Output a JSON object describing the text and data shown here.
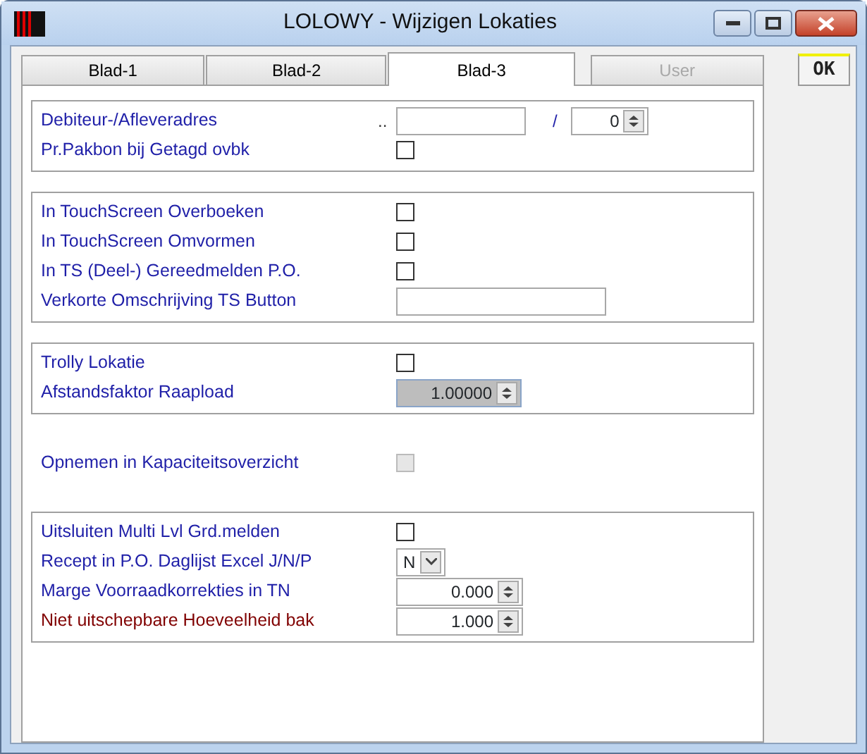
{
  "window": {
    "title": "LOLOWY - Wijzigen Lokaties"
  },
  "tabs": [
    {
      "label": "Blad-1",
      "selected": false,
      "disabled": false
    },
    {
      "label": "Blad-2",
      "selected": false,
      "disabled": false
    },
    {
      "label": "Blad-3",
      "selected": true,
      "disabled": false
    },
    {
      "label": "User",
      "selected": false,
      "disabled": true
    }
  ],
  "ok_button": {
    "label": "OK"
  },
  "groups": [
    {
      "bordered": true,
      "rows": [
        {
          "kind": "address",
          "label": "Debiteur-/Afleveradres",
          "color": "#1f1fa8",
          "prefix": "..",
          "separator": "/",
          "value": "0"
        },
        {
          "kind": "checkbox",
          "label": "Pr.Pakbon bij Getagd ovbk",
          "color": "#1f1fa8",
          "checked": false,
          "disabled": false
        }
      ]
    },
    {
      "bordered": true,
      "rows": [
        {
          "kind": "checkbox",
          "label": "In TouchScreen Overboeken",
          "color": "#1f1fa8",
          "checked": false,
          "disabled": false
        },
        {
          "kind": "checkbox",
          "label": "In TouchScreen Omvormen",
          "color": "#1f1fa8",
          "checked": false,
          "disabled": false
        },
        {
          "kind": "checkbox",
          "label": "In TS (Deel-) Gereedmelden P.O.",
          "color": "#1f1fa8",
          "checked": false,
          "disabled": false
        },
        {
          "kind": "text",
          "label": "Verkorte Omschrijving TS Button",
          "color": "#1f1fa8"
        }
      ]
    },
    {
      "bordered": true,
      "rows": [
        {
          "kind": "checkbox",
          "label": "Trolly Lokatie",
          "color": "#1f1fa8",
          "checked": false,
          "disabled": false
        },
        {
          "kind": "spin",
          "label": "Afstandsfaktor Raapload",
          "color": "#1f1fa8",
          "value": "1.00000",
          "disabled": true
        }
      ]
    },
    {
      "bordered": false,
      "rows": [
        {
          "kind": "checkbox",
          "label": "Opnemen in Kapaciteitsoverzicht",
          "color": "#1f1fa8",
          "checked": false,
          "disabled": true
        }
      ]
    },
    {
      "bordered": true,
      "rows": [
        {
          "kind": "checkbox",
          "label": "Uitsluiten Multi Lvl Grd.melden",
          "color": "#1f1fa8",
          "checked": false,
          "disabled": false
        },
        {
          "kind": "select",
          "label": "Recept in P.O. Daglijst Excel J/N/P",
          "color": "#1f1fa8",
          "value": "N"
        },
        {
          "kind": "spin",
          "label": "Marge Voorraadkorrekties in TN",
          "color": "#1f1fa8",
          "value": "0.000",
          "disabled": false
        },
        {
          "kind": "spin",
          "label": "Niet uitschepbare Hoeveelheid bak",
          "color": "#800000",
          "value": "1.000",
          "disabled": false
        }
      ]
    }
  ]
}
